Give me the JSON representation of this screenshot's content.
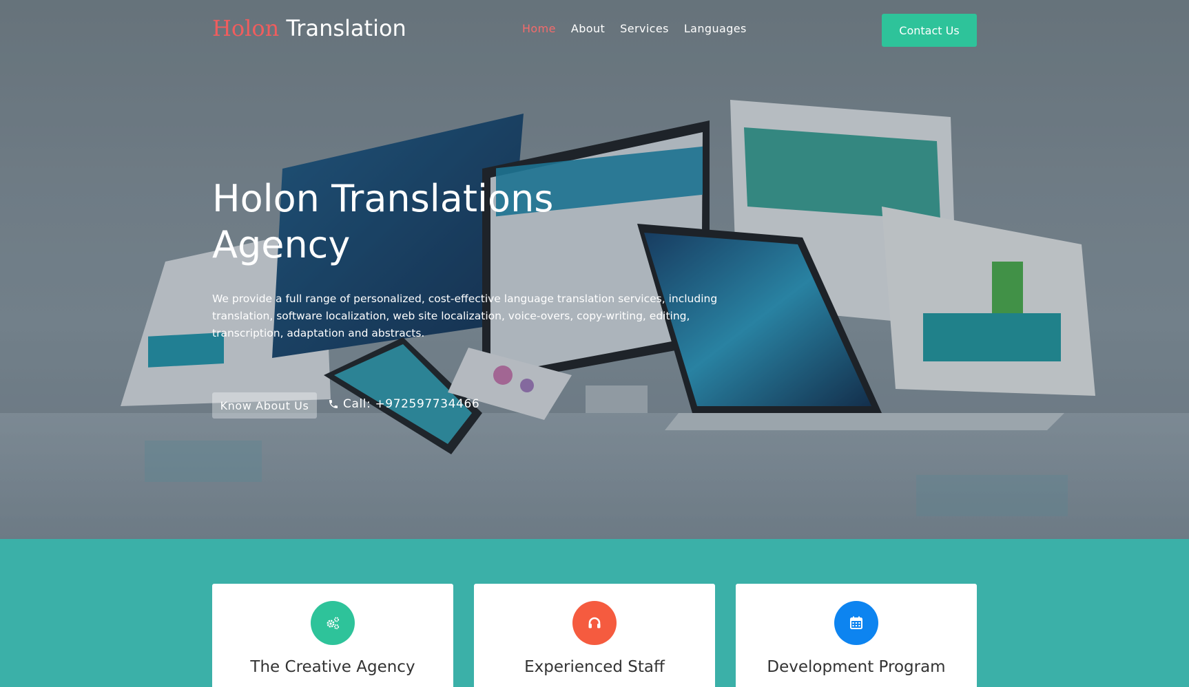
{
  "header": {
    "brand_first": "Holon",
    "brand_second": "Translation",
    "nav": [
      "Home",
      "About",
      "Services",
      "Languages"
    ],
    "active_nav": "Home",
    "contact_label": "Contact Us"
  },
  "hero": {
    "title": "Holon Translations Agency",
    "description": "We provide a full range of personalized, cost-effective language translation services, including translation, software localization, web site localization, voice-overs, copy-writing, editing, transcription, adaptation and abstracts.",
    "know_label": "Know About Us",
    "call_label": "Call: +972597734466",
    "call_icon": "phone-icon"
  },
  "features": [
    {
      "title": "The Creative Agency",
      "icon": "gears-icon",
      "color": "#2ec39a"
    },
    {
      "title": "Experienced Staff",
      "icon": "headphones-icon",
      "color": "#f55b3f"
    },
    {
      "title": "Development Program",
      "icon": "calendar-icon",
      "color": "#0d84f0"
    }
  ],
  "colors": {
    "brand_accent": "#f05d5e",
    "nav_active": "#f46b6b",
    "contact_button": "#2ec39a",
    "section_bg": "#3bb0a8"
  }
}
